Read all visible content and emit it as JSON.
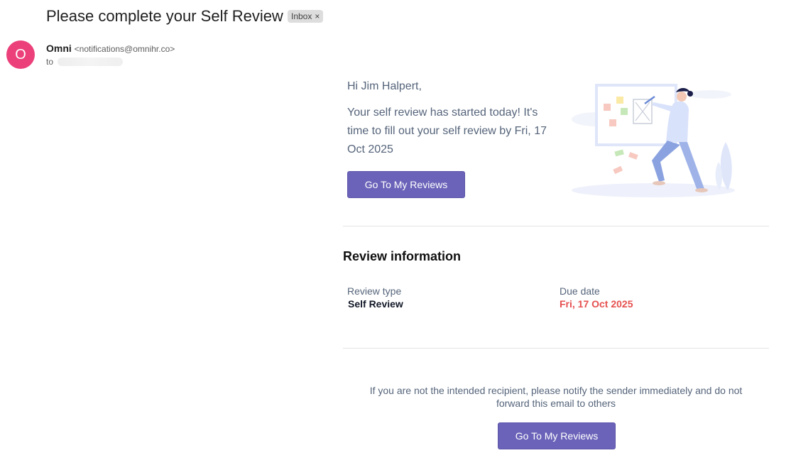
{
  "email": {
    "subject": "Please complete your Self Review",
    "label": "Inbox",
    "label_remove": "×",
    "sender": {
      "initial": "O",
      "name": "Omni",
      "address": "<notifications@omnihr.co>",
      "avatar_color": "#ec407a"
    },
    "to_prefix": "to"
  },
  "body": {
    "greeting": "Hi Jim Halpert,",
    "intro": "Your self review has started today! It's time to fill out your self review by Fri, 17 Oct 2025",
    "cta_label": "Go To My Reviews",
    "section_title": "Review information",
    "review_type_label": "Review type",
    "review_type_value": "Self Review",
    "due_date_label": "Due date",
    "due_date_value": "Fri, 17 Oct 2025",
    "footer_note": "If you are not the intended recipient, please notify the sender immediately and do not forward this email to others",
    "footer_cta_label": "Go To My Reviews"
  },
  "colors": {
    "button": "#6b63b9",
    "due_date": "#e5504f",
    "body_text": "#55647a"
  }
}
